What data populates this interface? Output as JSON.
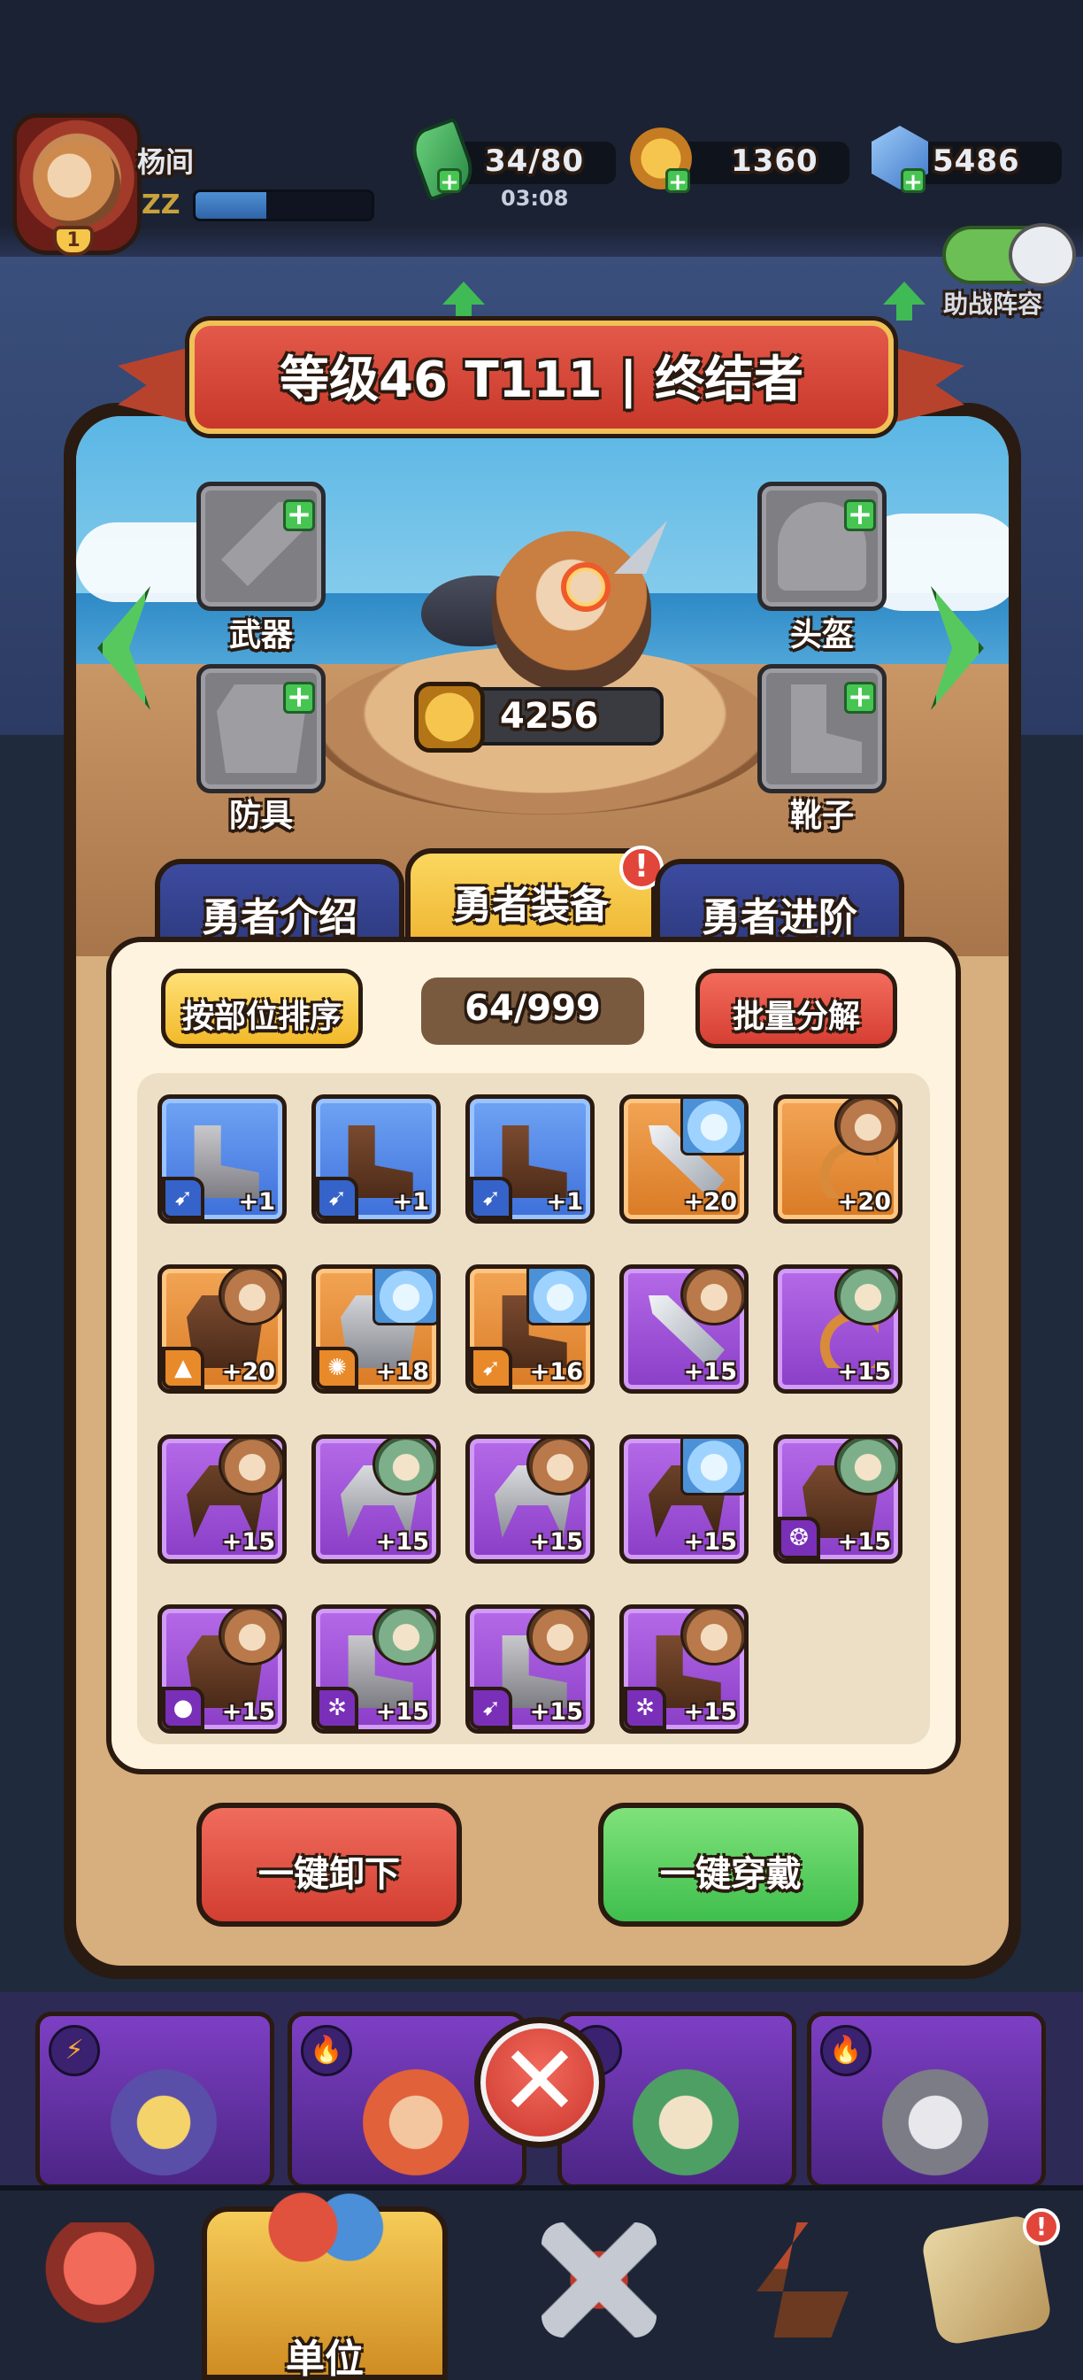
{
  "player": {
    "name": "杨间",
    "status_icon": "ZZ",
    "level_badge": "1",
    "xp_fraction": 0.4
  },
  "resources": {
    "energy": "34/80",
    "energy_timer": "03:08",
    "coins": "1360",
    "gems": "5486"
  },
  "support_toggle": {
    "label": "助战阵容",
    "on": true
  },
  "hero": {
    "title": "等级46 T111 | 终结者",
    "power": "4256",
    "slots": {
      "weapon": "武器",
      "helmet": "头盔",
      "armor": "防具",
      "boots": "靴子"
    }
  },
  "tabs": [
    {
      "label": "勇者介绍",
      "active": false
    },
    {
      "label": "勇者装备",
      "active": true,
      "alert": "!"
    },
    {
      "label": "勇者进阶",
      "active": false
    }
  ],
  "inventory": {
    "sort_button": "按部位排序",
    "count": "64/999",
    "decompose_button": "批量分解",
    "items": [
      {
        "type": "boots",
        "rarity": "blue",
        "level": "+1",
        "owner": "none",
        "badge": "➹"
      },
      {
        "type": "boots",
        "rarity": "blue",
        "level": "+1",
        "owner": "none",
        "badge": "➹"
      },
      {
        "type": "boots",
        "rarity": "blue",
        "level": "+1",
        "owner": "none",
        "badge": "➹"
      },
      {
        "type": "sword",
        "rarity": "orange",
        "level": "+20",
        "owner": "ice",
        "badge": ""
      },
      {
        "type": "bow",
        "rarity": "orange",
        "level": "+20",
        "owner": "dwarf",
        "badge": ""
      },
      {
        "type": "armor",
        "rarity": "orange",
        "level": "+20",
        "owner": "dwarf",
        "badge": "▲"
      },
      {
        "type": "armor",
        "rarity": "orange",
        "level": "+18",
        "owner": "ice",
        "badge": "✺"
      },
      {
        "type": "boots",
        "rarity": "orange",
        "level": "+16",
        "owner": "ice",
        "badge": "➹"
      },
      {
        "type": "sword",
        "rarity": "purple",
        "level": "+15",
        "owner": "cat",
        "badge": ""
      },
      {
        "type": "bow",
        "rarity": "purple",
        "level": "+15",
        "owner": "green",
        "badge": ""
      },
      {
        "type": "helm",
        "rarity": "purple",
        "level": "+15",
        "owner": "dwarf",
        "badge": ""
      },
      {
        "type": "helm",
        "rarity": "purple",
        "level": "+15",
        "owner": "green",
        "badge": ""
      },
      {
        "type": "helm",
        "rarity": "purple",
        "level": "+15",
        "owner": "cat",
        "badge": ""
      },
      {
        "type": "helm",
        "rarity": "purple",
        "level": "+15",
        "owner": "ice",
        "badge": ""
      },
      {
        "type": "armor",
        "rarity": "purple",
        "level": "+15",
        "owner": "green",
        "badge": "❂"
      },
      {
        "type": "armor",
        "rarity": "purple",
        "level": "+15",
        "owner": "cat",
        "badge": "●"
      },
      {
        "type": "boots",
        "rarity": "purple",
        "level": "+15",
        "owner": "green",
        "badge": "✲"
      },
      {
        "type": "boots",
        "rarity": "purple",
        "level": "+15",
        "owner": "cat",
        "badge": "➹"
      },
      {
        "type": "boots",
        "rarity": "purple",
        "level": "+15",
        "owner": "dwarf",
        "badge": "✲"
      }
    ]
  },
  "actions": {
    "unequip_all": "一键卸下",
    "equip_all": "一键穿戴"
  },
  "hero_cards": [
    {
      "element": "⚡"
    },
    {
      "element": "🔥"
    },
    {
      "element": ""
    },
    {
      "element": "🔥"
    }
  ],
  "bottom_nav": {
    "units_label": "单位",
    "alert": "!"
  },
  "colors": {
    "rarity_blue": "#4a7fe4",
    "rarity_orange": "#e58c34",
    "rarity_purple": "#9a4fd6",
    "title_red": "#d6463a",
    "confirm_green": "#4cc552"
  }
}
